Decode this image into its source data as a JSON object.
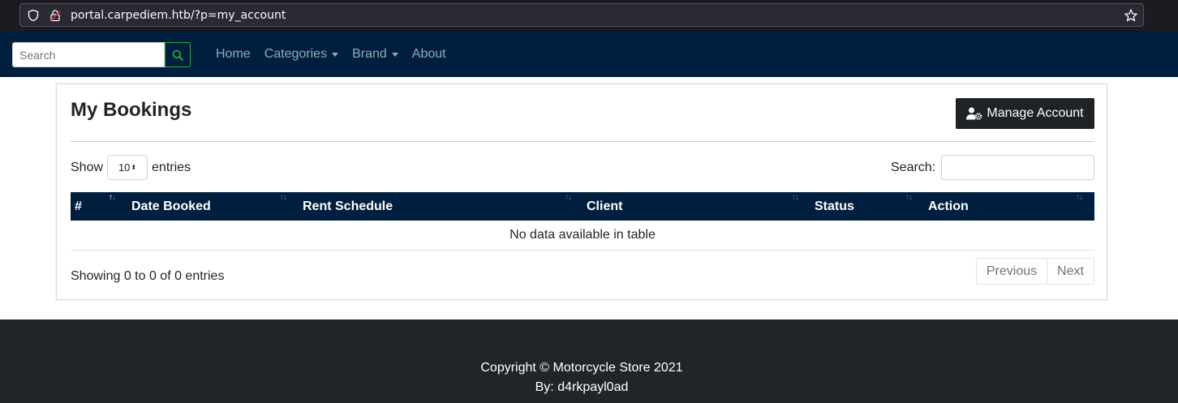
{
  "browser": {
    "url": "portal.carpediem.htb/?p=my_account"
  },
  "navbar": {
    "search_placeholder": "Search",
    "links": [
      {
        "label": "Home"
      },
      {
        "label": "Categories"
      },
      {
        "label": "Brand"
      },
      {
        "label": "About"
      }
    ]
  },
  "card": {
    "title": "My Bookings",
    "manage_button": "Manage Account",
    "show_label": "Show",
    "entries_label": "entries",
    "page_length": "10",
    "search_label": "Search:",
    "columns": [
      "#",
      "Date Booked",
      "Rent Schedule",
      "Client",
      "Status",
      "Action"
    ],
    "empty_message": "No data available in table",
    "info": "Showing 0 to 0 of 0 entries",
    "pagination": {
      "previous": "Previous",
      "next": "Next"
    }
  },
  "footer": {
    "copyright": "Copyright © Motorcycle Store 2021",
    "author": "By: d4rkpayl0ad"
  },
  "colors": {
    "navbar": "#001f3f",
    "footer": "#212529",
    "search_button_border": "#28a745"
  }
}
